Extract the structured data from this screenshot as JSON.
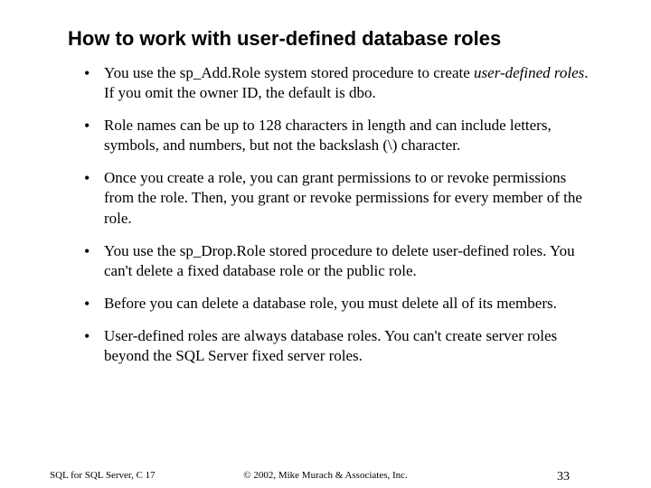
{
  "title": "How to work with user-defined database roles",
  "bullets": [
    {
      "prefix": "You use the sp_Add.Role system stored procedure to create ",
      "italic": "user-defined roles",
      "suffix": ". If you omit the owner ID, the default is dbo."
    },
    {
      "text": "Role names can be up to 128 characters in length and can include letters, symbols, and numbers, but not the backslash (\\) character."
    },
    {
      "text": "Once you create a role, you can grant permissions to or revoke permissions from the role. Then, you grant or revoke permissions for every member of the role."
    },
    {
      "text": "You use the sp_Drop.Role stored procedure to delete user-defined roles. You can't delete a fixed database role or the public role."
    },
    {
      "text": "Before you can delete a database role, you must delete all of its members."
    },
    {
      "text": "User-defined roles are always database roles. You can't create server roles beyond the SQL Server fixed server roles."
    }
  ],
  "footer": {
    "left": "SQL for SQL Server, C 17",
    "center": "© 2002, Mike Murach & Associates, Inc.",
    "right": "33"
  }
}
